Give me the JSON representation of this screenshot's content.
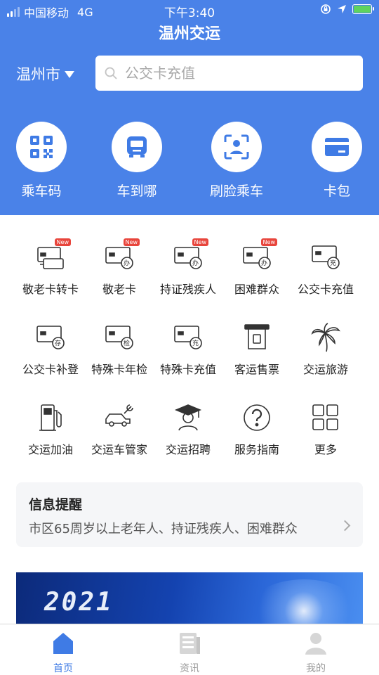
{
  "status_bar": {
    "carrier": "中国移动",
    "network": "4G",
    "time": "下午3:40"
  },
  "header": {
    "title": "温州交运",
    "city": "温州市",
    "search_placeholder": "公交卡充值"
  },
  "quick_actions": [
    {
      "label": "乘车码",
      "icon": "qr-code-icon"
    },
    {
      "label": "车到哪",
      "icon": "bus-icon"
    },
    {
      "label": "刷脸乘车",
      "icon": "face-scan-icon"
    },
    {
      "label": "卡包",
      "icon": "card-wallet-icon"
    }
  ],
  "services": [
    {
      "label": "敬老卡转卡",
      "icon": "card-transfer-icon",
      "badge": "New"
    },
    {
      "label": "敬老卡",
      "icon": "card-apply-icon",
      "badge": "New",
      "mark": "办"
    },
    {
      "label": "持证残疾人",
      "icon": "card-apply-icon",
      "badge": "New",
      "mark": "办"
    },
    {
      "label": "困难群众",
      "icon": "card-apply-icon",
      "badge": "New",
      "mark": "办"
    },
    {
      "label": "公交卡充值",
      "icon": "card-recharge-icon",
      "mark": "充"
    },
    {
      "label": "公交卡补登",
      "icon": "card-deposit-icon",
      "mark": "存"
    },
    {
      "label": "特殊卡年检",
      "icon": "card-inspect-icon",
      "mark": "检"
    },
    {
      "label": "特殊卡充值",
      "icon": "card-recharge-icon",
      "mark": "充"
    },
    {
      "label": "客运售票",
      "icon": "ticket-icon"
    },
    {
      "label": "交运旅游",
      "icon": "palm-tree-icon"
    },
    {
      "label": "交运加油",
      "icon": "fuel-pump-icon"
    },
    {
      "label": "交运车管家",
      "icon": "car-wrench-icon"
    },
    {
      "label": "交运招聘",
      "icon": "graduate-icon"
    },
    {
      "label": "服务指南",
      "icon": "help-icon"
    },
    {
      "label": "更多",
      "icon": "grid-icon"
    }
  ],
  "notice": {
    "title": "信息提醒",
    "text": "市区65周岁以上老年人、持证残疾人、困难群众"
  },
  "banner": {
    "year": "2021"
  },
  "tab_bar": [
    {
      "label": "首页",
      "icon": "home-icon",
      "active": true
    },
    {
      "label": "资讯",
      "icon": "news-icon",
      "active": false
    },
    {
      "label": "我的",
      "icon": "user-icon",
      "active": false
    }
  ],
  "colors": {
    "primary": "#4a82e8",
    "active_tab": "#3f7be5",
    "badge": "#e8453c"
  }
}
